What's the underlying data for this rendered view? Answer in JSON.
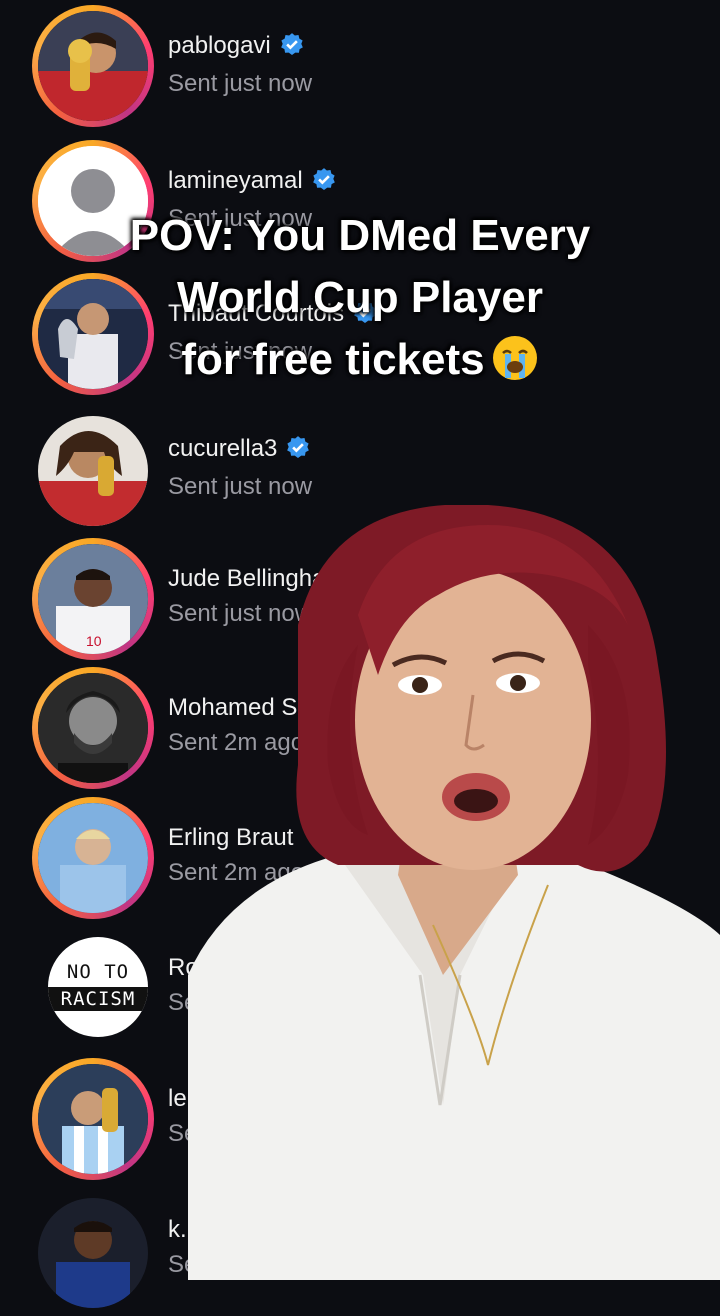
{
  "overlay": {
    "line1": "POV: You DMed Every",
    "line2": "World Cup Player",
    "line3": "for free tickets",
    "emoji_icon": "crying-face-emoji"
  },
  "conversations": [
    {
      "name": "pablogavi",
      "status": "Sent just now",
      "verified": true,
      "ring": true,
      "avatar": "trophy-player"
    },
    {
      "name": "lamineyamal",
      "status": "Sent just now",
      "verified": true,
      "ring": true,
      "avatar": "default-user"
    },
    {
      "name": "Thibaut Courtois",
      "status": "Sent just now",
      "verified": true,
      "ring": true,
      "avatar": "stadium-player"
    },
    {
      "name": "cucurella3",
      "status": "Sent just now",
      "verified": true,
      "ring": false,
      "avatar": "trophy-player"
    },
    {
      "name": "Jude Bellingham",
      "status": "Sent just now",
      "verified": true,
      "ring": true,
      "avatar": "england-player"
    },
    {
      "name": "Mohamed S",
      "status": "Sent 2m ago",
      "verified": false,
      "ring": true,
      "avatar": "bw-portrait"
    },
    {
      "name": "Erling Braut",
      "status": "Sent 2m ago",
      "verified": false,
      "ring": true,
      "avatar": "city-player"
    },
    {
      "name": "Ron",
      "status": "Se",
      "verified": false,
      "ring": false,
      "avatar": "no-to-racism"
    },
    {
      "name": "le",
      "status": "Se",
      "verified": false,
      "ring": true,
      "avatar": "argentina-player"
    },
    {
      "name": "k.",
      "status": "Se",
      "verified": false,
      "ring": false,
      "avatar": "france-player"
    }
  ],
  "noracism": {
    "line1": "NO TO",
    "line2": "RACISM"
  },
  "colors": {
    "background": "#0c0d12",
    "verified_blue": "#3897f0",
    "status_gray": "#9a9aa2",
    "hair": "#8e1f2b"
  }
}
